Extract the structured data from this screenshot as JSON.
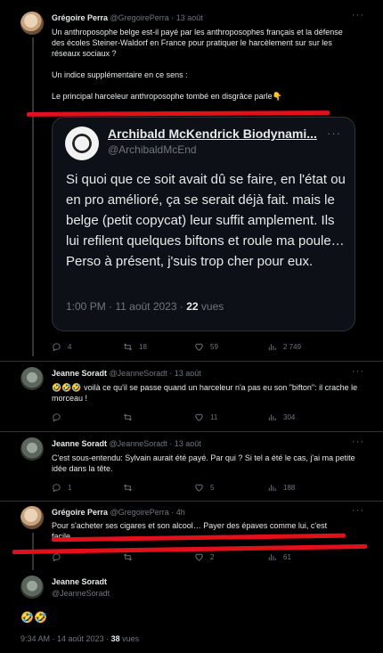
{
  "tweet1": {
    "name": "Grégoire Perra",
    "handle": "@GregoirePerra",
    "date": "13 août",
    "text": "Un anthroposophe belge est-il payé par les anthroposophes français et la défense des écoles Steiner-Waldorf en France pour pratiquer le harcèlement sur sur les réseaux sociaux ?\n\nUn indice supplémentaire en ce sens :\n\nLe principal harceleur anthroposophe tombé en disgrâce parle👇",
    "replies": "4",
    "retweets": "18",
    "likes": "59",
    "views": "2 749"
  },
  "quote": {
    "name": "Archibald McKendrick Biodynami...",
    "handle": "@ArchibaldMcEnd",
    "text": "Si quoi que ce soit avait dû se faire, en l'état ou en pro amélioré, ça se serait déjà fait. mais le belge (petit copycat) leur suffit amplement. Ils lui refilent quelques biftons et roule ma poule…\nPerso à présent, j'suis trop cher pour eux.",
    "time": "1:00 PM · 11 août 2023 · ",
    "views_count": "22",
    "views_label": " vues"
  },
  "tweet2": {
    "name": "Jeanne Soradt",
    "handle": "@JeanneSoradt",
    "date": "13 août",
    "text": "🤣🤣🤣 voilà ce qu'il se passe quand un harceleur n'a pas eu son \"bifton\": il crache le morceau !",
    "replies": "",
    "retweets": "",
    "likes": "11",
    "views": "304"
  },
  "tweet3": {
    "name": "Jeanne Soradt",
    "handle": "@JeanneSoradt",
    "date": "13 août",
    "text": "C'est sous-entendu: Sylvain aurait été payé. Par qui ? Si tel a été le cas, j'ai ma petite idée dans la tête.",
    "replies": "1",
    "retweets": "",
    "likes": "5",
    "views": "188"
  },
  "tweet4": {
    "name": "Grégoire Perra",
    "handle": "@GregoirePerra",
    "date": "4h",
    "text": "Pour s'acheter ses cigares et son alcool… Payer des épaves comme lui, c'est facile.",
    "replies": "",
    "retweets": "",
    "likes": "2",
    "views": "61"
  },
  "main": {
    "name": "Jeanne Soradt",
    "handle": "@JeanneSoradt",
    "text": "🤣🤣",
    "time": "9:34 AM · 14 août 2023 · ",
    "views_count": "38",
    "views_label": " vues"
  },
  "more_label": "···",
  "colors": {
    "accent_red": "#e3101b",
    "background": "#000000",
    "muted": "#71767b"
  }
}
